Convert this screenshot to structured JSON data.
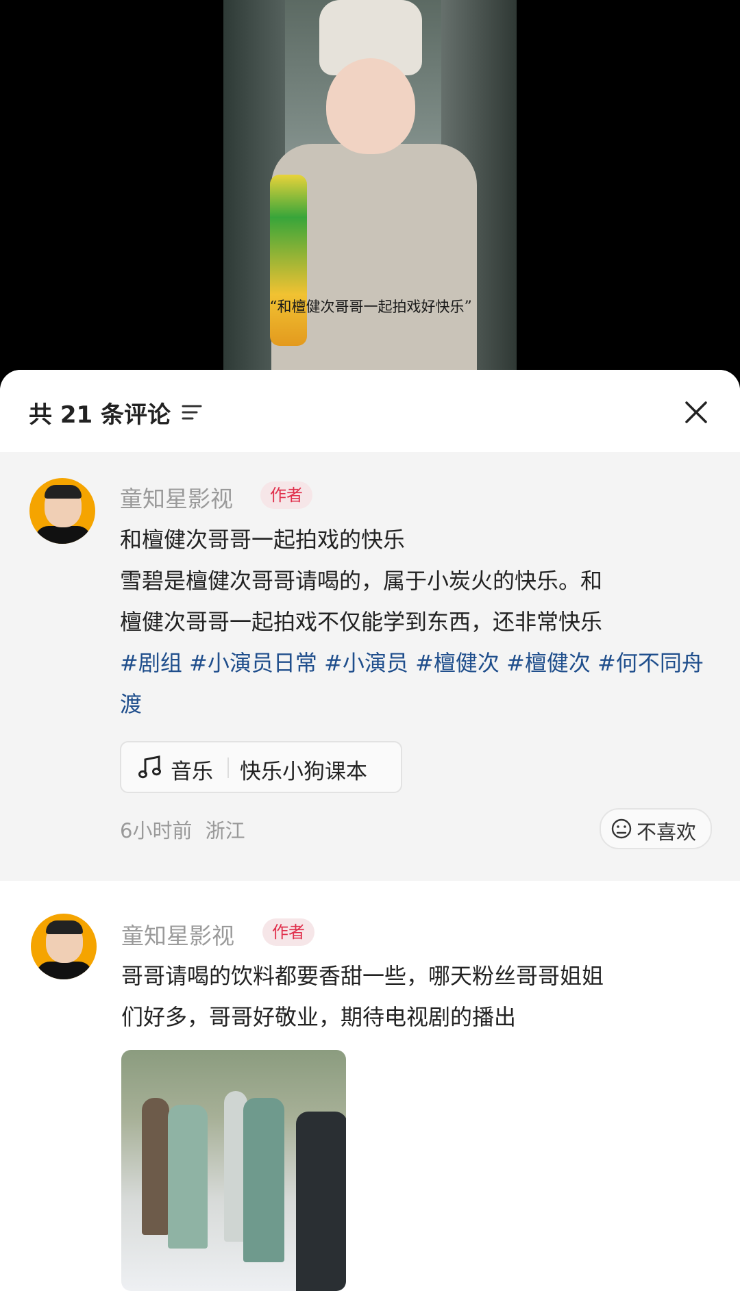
{
  "video": {
    "caption_open": "“",
    "caption": "和檀健次哥哥一起拍戏好快乐",
    "caption_close": "”"
  },
  "panel": {
    "title": "共 21 条评论",
    "sort_icon": "sort-icon",
    "close_icon": "close-icon"
  },
  "comments": [
    {
      "author": "童知星影视",
      "badge": "作者",
      "line1": "和檀健次哥哥一起拍戏的快乐",
      "line2": "雪碧是檀健次哥哥请喝的，属于小炭火的快乐。和",
      "line3": "檀健次哥哥一起拍戏不仅能学到东西，还非常快乐",
      "tags": [
        "#剧组",
        "#小演员日常",
        "#小演员",
        "#檀健次",
        "#檀健次",
        "#何不同舟渡"
      ],
      "music_label": "音乐",
      "music_title": "快乐小狗课本",
      "time": "6小时前",
      "location": "浙江",
      "dislike": "不喜欢"
    },
    {
      "author": "童知星影视",
      "badge": "作者",
      "line1": "哥哥请喝的饮料都要香甜一些，哪天粉丝哥哥姐姐",
      "line2": "们好多，哥哥好敬业，期待电视剧的播出"
    }
  ]
}
